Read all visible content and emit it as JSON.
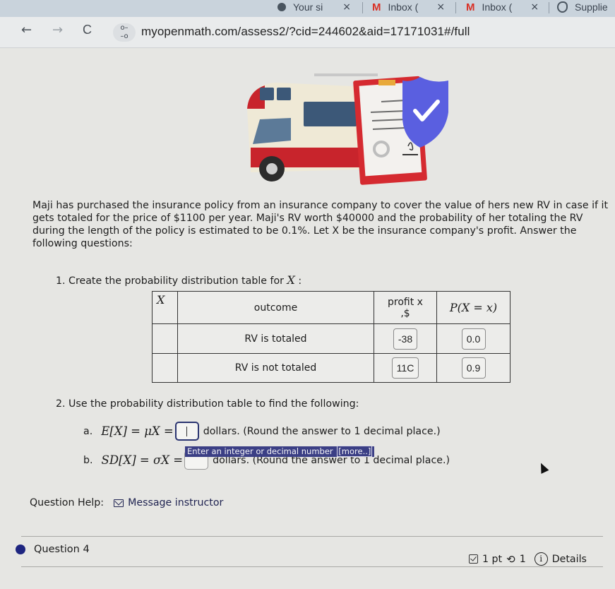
{
  "browser": {
    "tabs": [
      {
        "title": "Your si",
        "icon": "globe-icon"
      },
      {
        "title": "Inbox (",
        "icon": "gmail-icon"
      },
      {
        "title": "Inbox (",
        "icon": "gmail-icon"
      },
      {
        "title": "Supplie",
        "icon": "supplies-icon"
      }
    ],
    "close_glyph": "×",
    "nav": {
      "back": "←",
      "forward": "→",
      "reload": "C"
    },
    "site_info_glyph": "⚬‒\n‒⚬",
    "url": "myopenmath.com/assess2/?cid=244602&aid=17171031#/full"
  },
  "question": {
    "image_alt": "RV with insurance policy document and shield checkmark",
    "problem_text": "Maji has purchased the insurance policy from an insurance company to cover the value of hers new RV in case if it gets totaled for the price of $1100 per year. Maji's RV worth $40000 and the probability of her totaling the RV during the length of the policy is estimated to be 0.1%. Let X  be the insurance company's profit. Answer the following questions:",
    "part1": {
      "label": "1. Create the probability distribution table for",
      "var": "X",
      "suffix": " :"
    },
    "table": {
      "headers": {
        "x": "X",
        "outcome": "outcome",
        "profit": "profit x",
        "profit_unit": ",$",
        "prob": "P(X = x)"
      },
      "rows": [
        {
          "outcome": "RV is totaled",
          "profit": "-38",
          "prob": "0.0"
        },
        {
          "outcome": "RV is not totaled",
          "profit": "11C",
          "prob": "0.9"
        }
      ]
    },
    "part2": {
      "label": "2. Use the probability distribution table to find the following:",
      "a": {
        "prefix": "a.",
        "math": "E[X] = μX =",
        "value": "",
        "suffix": "dollars. (Round the answer to 1 decimal place.)"
      },
      "b": {
        "prefix": "b.",
        "math": "SD[X] = σX =",
        "value": "",
        "suffix": "dollars. (Round the answer to 1 decimal place.)"
      },
      "tooltip": "Enter an integer or decimal number",
      "tooltip_more": "[more..]"
    },
    "help": {
      "label": "Question Help:",
      "link": "Message instructor"
    }
  },
  "next_question": {
    "title": "Question 4",
    "points": "1 pt",
    "attempts": "1",
    "details": "Details",
    "accent": "#1e2580"
  }
}
